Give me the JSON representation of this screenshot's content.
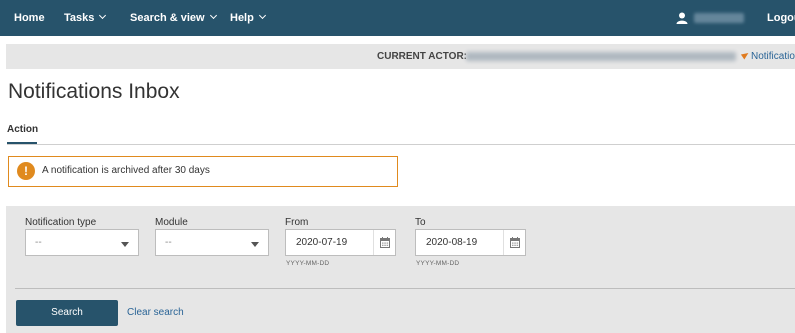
{
  "nav": {
    "items": [
      {
        "label": "Home",
        "has_menu": false
      },
      {
        "label": "Tasks",
        "has_menu": true
      },
      {
        "label": "Search & view",
        "has_menu": true
      },
      {
        "label": "Help",
        "has_menu": true
      }
    ],
    "user_icon": "user-icon",
    "logout_label": "Logout",
    "bar_color": "#27536b"
  },
  "actor_bar": {
    "label": "CURRENT ACTOR:",
    "notifications_link": "Notifications"
  },
  "page": {
    "title": "Notifications Inbox",
    "tabs": [
      {
        "label": "Action",
        "active": true
      }
    ]
  },
  "alert": {
    "icon": "exclamation-icon",
    "message": "A notification is archived after 30 days",
    "border_color": "#e08a1e"
  },
  "filters": {
    "notification_type": {
      "label": "Notification type",
      "value": "--"
    },
    "module": {
      "label": "Module",
      "value": "--"
    },
    "from": {
      "label": "From",
      "value": "2020-07-19",
      "hint": "YYYY-MM-DD"
    },
    "to": {
      "label": "To",
      "value": "2020-08-19",
      "hint": "YYYY-MM-DD"
    },
    "search_label": "Search",
    "clear_label": "Clear search"
  }
}
